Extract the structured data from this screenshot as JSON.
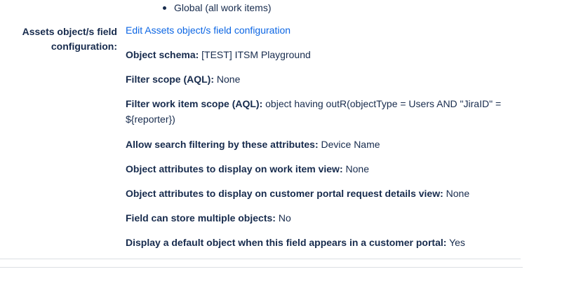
{
  "scope": {
    "bullet_item": "Global (all work items)"
  },
  "assets_field": {
    "label_line1": "Assets object/s field",
    "label_line2": "configuration:",
    "edit_link": "Edit Assets object/s field configuration",
    "properties": [
      {
        "label": "Object schema:",
        "value": "[TEST] ITSM Playground"
      },
      {
        "label": "Filter scope (AQL):",
        "value": "None"
      },
      {
        "label": "Filter work item scope (AQL):",
        "value": "object having outR(objectType = Users AND \"JiraID\" = ${reporter})"
      },
      {
        "label": "Allow search filtering by these attributes:",
        "value": "Device Name"
      },
      {
        "label": "Object attributes to display on work item view:",
        "value": "None"
      },
      {
        "label": "Object attributes to display on customer portal request details view:",
        "value": "None"
      },
      {
        "label": "Field can store multiple objects:",
        "value": "No"
      },
      {
        "label": "Display a default object when this field appears in a customer portal:",
        "value": "Yes"
      }
    ]
  }
}
